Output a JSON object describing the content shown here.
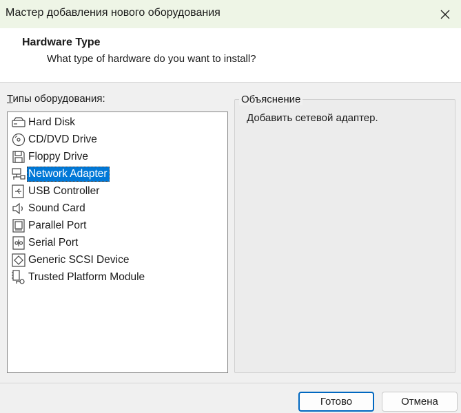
{
  "window": {
    "title": "Мастер добавления нового оборудования",
    "close_icon": "close-icon"
  },
  "header": {
    "title": "Hardware Type",
    "subtitle": "What type of hardware do you want to install?"
  },
  "hardware_list": {
    "label_accesskey": "Т",
    "label_rest": "ипы оборудования:",
    "selected_index": 3,
    "items": [
      {
        "label": "Hard Disk",
        "icon": "hard-disk-icon"
      },
      {
        "label": "CD/DVD Drive",
        "icon": "cd-dvd-icon"
      },
      {
        "label": "Floppy Drive",
        "icon": "floppy-icon"
      },
      {
        "label": "Network Adapter",
        "icon": "network-adapter-icon"
      },
      {
        "label": "USB Controller",
        "icon": "usb-icon"
      },
      {
        "label": "Sound Card",
        "icon": "speaker-icon"
      },
      {
        "label": "Parallel Port",
        "icon": "parallel-port-icon"
      },
      {
        "label": "Serial Port",
        "icon": "serial-port-icon"
      },
      {
        "label": "Generic SCSI Device",
        "icon": "scsi-icon"
      },
      {
        "label": "Trusted Platform Module",
        "icon": "tpm-icon"
      }
    ]
  },
  "explanation": {
    "legend": "Объяснение",
    "text": "Добавить сетевой адаптер."
  },
  "buttons": {
    "ok": "Готово",
    "cancel": "Отмена"
  },
  "colors": {
    "titlebar_bg": "#eef5e6",
    "selection_bg": "#0078d7",
    "default_button_border": "#0067c0"
  }
}
